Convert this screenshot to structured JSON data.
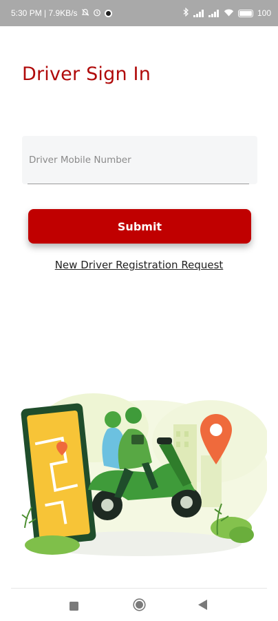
{
  "status_bar": {
    "time_and_speed": "5:30 PM | 7.9KB/s",
    "battery_text": "100",
    "icons": [
      "mute-icon",
      "alarm-icon",
      "record-icon",
      "bluetooth-icon",
      "signal-icon",
      "volte-icon",
      "wifi-icon",
      "battery-icon"
    ]
  },
  "header": {
    "title": "Driver Sign In"
  },
  "form": {
    "mobile_placeholder": "Driver Mobile Number",
    "mobile_value": "",
    "submit_label": "Submit",
    "register_link": "New Driver Registration Request"
  },
  "illustration": {
    "name": "delivery-scooter-map-illustration"
  },
  "nav_bar": {
    "icons": [
      "recent-apps-icon",
      "home-icon",
      "back-icon"
    ]
  },
  "colors": {
    "accent": "#b00a0a",
    "button": "#c00000",
    "status_bar_bg": "#a9a9a9",
    "input_bg": "#f5f6f7"
  }
}
